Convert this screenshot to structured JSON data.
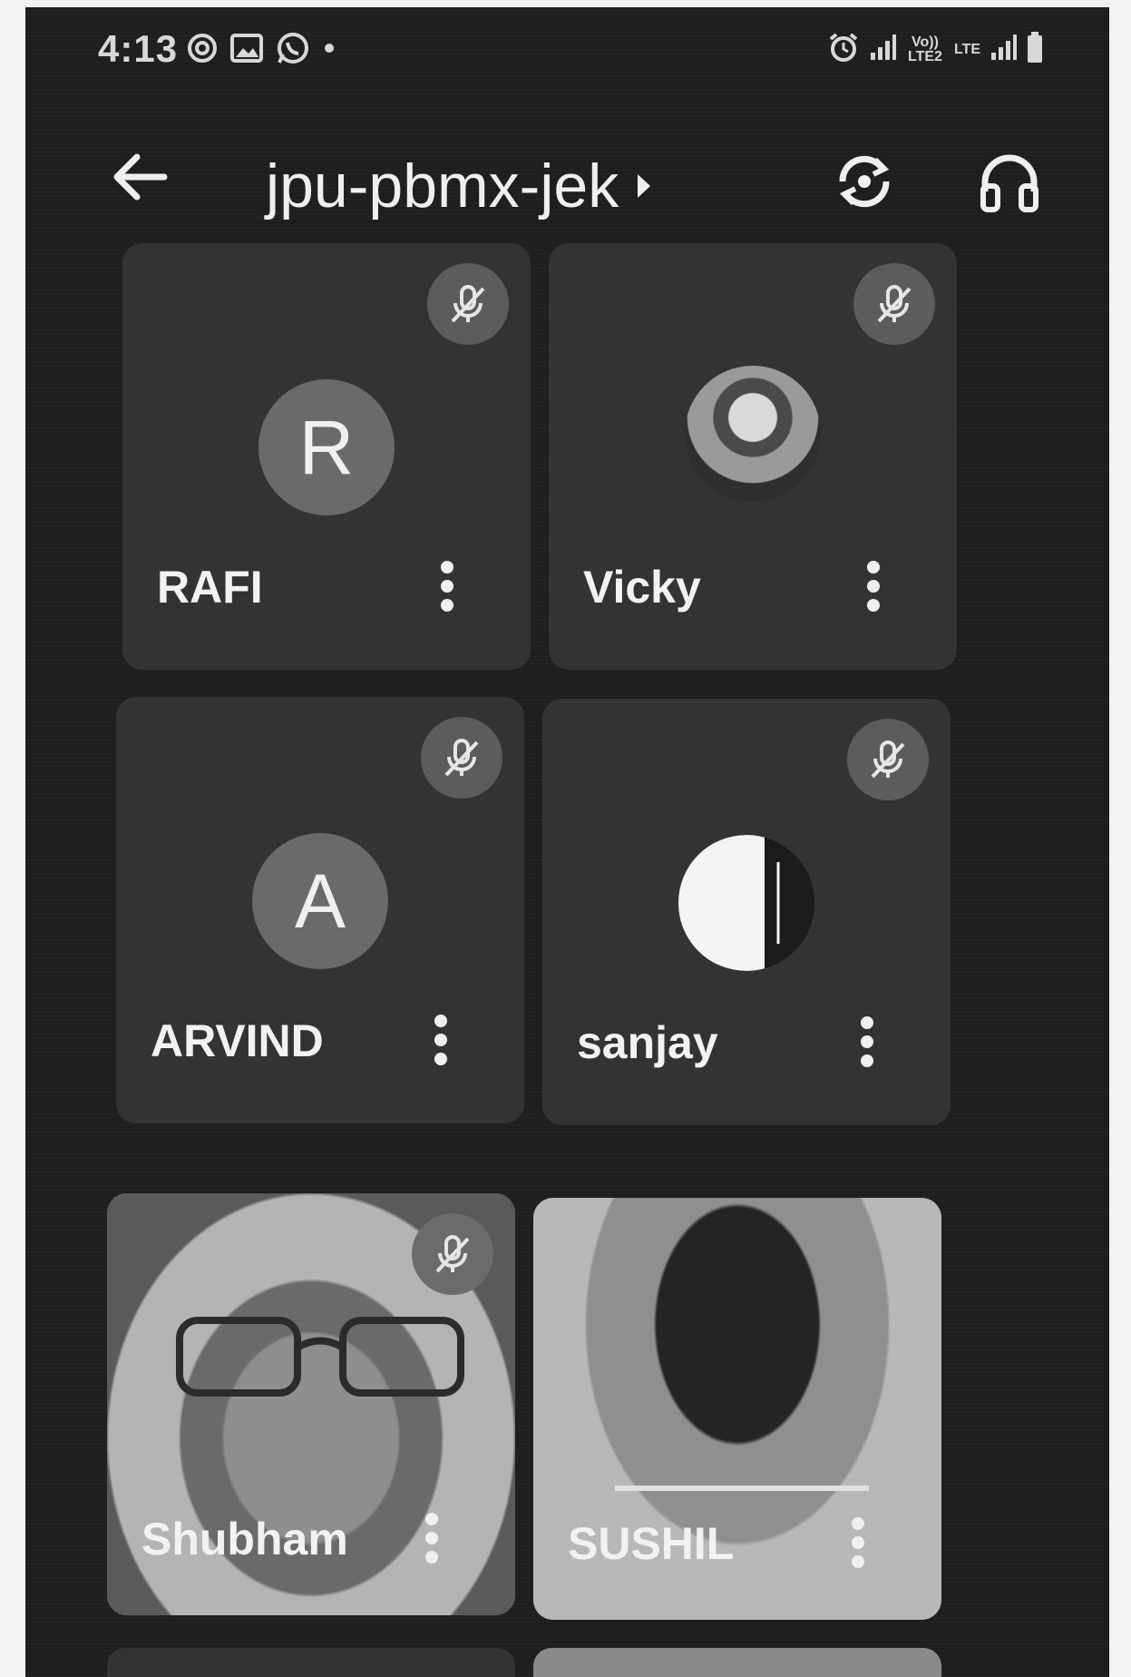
{
  "status_bar": {
    "time": "4:13",
    "left_icons": [
      "sync-icon",
      "gallery-icon",
      "whatsapp-icon",
      "dot-icon"
    ],
    "right_icons": [
      "alarm-icon",
      "signal-icon",
      "volte-icon",
      "lte-icon",
      "signal-icon",
      "battery-icon"
    ],
    "volte_label": "Vo)) LTE2",
    "lte_label": "LTE"
  },
  "app_bar": {
    "meeting_code": "jpu-pbmx-jek",
    "icons": [
      "back-arrow-icon",
      "chevron-right-icon",
      "switch-camera-icon",
      "headphones-icon"
    ]
  },
  "participants": [
    {
      "name": "RAFI",
      "avatar_letter": "R",
      "muted": true,
      "video": false
    },
    {
      "name": "Vicky",
      "avatar_letter": "",
      "muted": true,
      "video": false
    },
    {
      "name": "ARVIND",
      "avatar_letter": "A",
      "muted": true,
      "video": false
    },
    {
      "name": "sanjay",
      "avatar_letter": "",
      "muted": true,
      "video": false
    },
    {
      "name": "Shubham",
      "avatar_letter": "",
      "muted": true,
      "video": true
    },
    {
      "name": "SUSHIL",
      "avatar_letter": "",
      "muted": false,
      "video": true
    }
  ],
  "colors": {
    "background": "#1e1e1e",
    "tile": "#333333",
    "mute_badge": "#5c5c5c",
    "avatar": "#6a6a6a",
    "text": "#f2f2f2"
  }
}
